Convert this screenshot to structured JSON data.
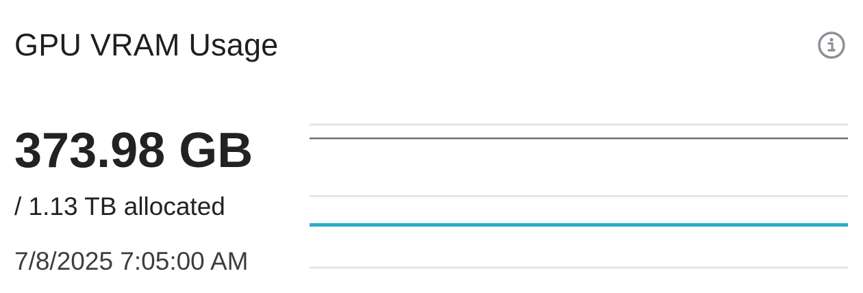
{
  "widget": {
    "title": "GPU VRAM Usage",
    "info_icon": "info-circle-icon",
    "current_value": "373.98 GB",
    "allocated_text": "/ 1.13 TB allocated",
    "timestamp": "7/8/2025 7:05:00 AM"
  },
  "colors": {
    "text_primary": "#1f1f1f",
    "usage_line": "#29adc6",
    "limit_line": "#6b6f7a",
    "gridline": "#e3e3ea",
    "icon": "#8f8f96"
  },
  "chart_data": {
    "type": "line",
    "grid": true,
    "series": [
      {
        "values": [
          0.374,
          0.374
        ]
      },
      {
        "values": [
          1.13,
          1.13
        ]
      }
    ]
  }
}
